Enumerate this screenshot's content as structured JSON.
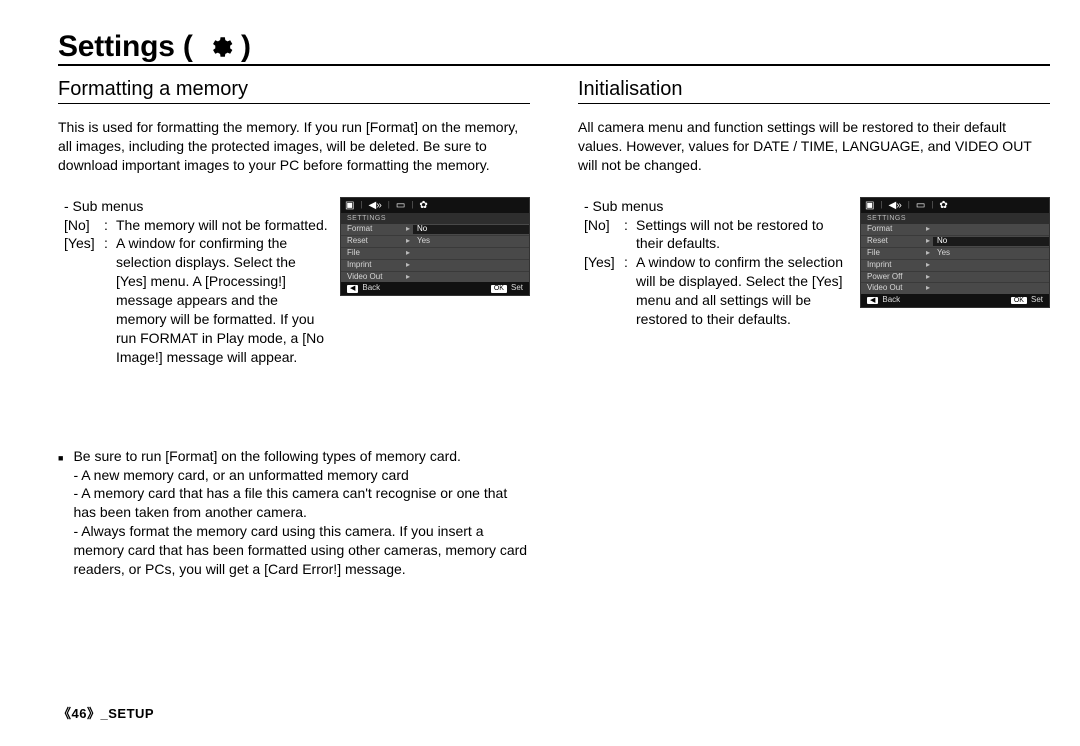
{
  "title": "Settings (",
  "title_close": " )",
  "left": {
    "heading": "Formatting a memory",
    "intro": "This is used for formatting the memory. If you run [Format] on the memory, all images, including the protected images, will be deleted. Be sure to download important images to your PC before formatting the memory.",
    "sub_header": "- Sub menus",
    "rows": [
      {
        "label": "[No]",
        "desc": "The memory will not be formatted."
      },
      {
        "label": "[Yes]",
        "desc": "A window for confirming the selection displays. Select the [Yes] menu. A [Processing!] message appears and the memory will be formatted. If you run FORMAT in Play mode, a [No Image!] message will appear."
      }
    ],
    "menu": {
      "title": "SETTINGS",
      "rows": [
        {
          "label": "Format",
          "val": "No",
          "sel": true
        },
        {
          "label": "Reset",
          "val": "Yes"
        },
        {
          "label": "File",
          "val": ""
        },
        {
          "label": "Imprint",
          "val": ""
        },
        {
          "label": "Video Out",
          "val": ""
        }
      ],
      "foot_left_btn": "◀",
      "foot_left_txt": "Back",
      "foot_right_btn": "OK",
      "foot_right_txt": "Set"
    },
    "note_lead": "Be sure to run [Format] on the following types of memory card.",
    "note_items": [
      "- A new memory card, or an unformatted memory card",
      "- A memory card that has a file this camera can't recognise or one that has been taken from another camera.",
      "- Always format the memory card using this camera. If you insert a memory card that has been formatted using other cameras, memory card readers, or PCs, you will get a [Card Error!] message."
    ]
  },
  "right": {
    "heading": "Initialisation",
    "intro": "All camera menu and function settings will be restored to their default values. However, values for DATE / TIME, LANGUAGE, and VIDEO OUT will not be changed.",
    "sub_header": "- Sub menus",
    "rows": [
      {
        "label": "[No]",
        "desc": "Settings will not be restored to their defaults."
      },
      {
        "label": "[Yes]",
        "desc": "A window to confirm the selection will be displayed. Select the [Yes] menu and all settings will be restored to their defaults."
      }
    ],
    "menu": {
      "title": "SETTINGS",
      "rows": [
        {
          "label": "Format",
          "val": ""
        },
        {
          "label": "Reset",
          "val": "No",
          "sel": true
        },
        {
          "label": "File",
          "val": "Yes"
        },
        {
          "label": "Imprint",
          "val": ""
        },
        {
          "label": "Power Off",
          "val": ""
        },
        {
          "label": "Video Out",
          "val": ""
        }
      ],
      "foot_left_btn": "◀",
      "foot_left_txt": "Back",
      "foot_right_btn": "OK",
      "foot_right_txt": "Set"
    }
  },
  "footer": {
    "page": "46",
    "section": "SETUP"
  }
}
